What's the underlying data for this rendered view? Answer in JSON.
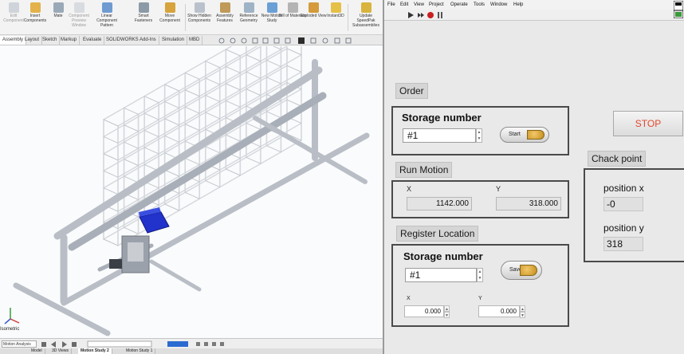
{
  "cad": {
    "ribbon": [
      {
        "label": "Edit Component",
        "disabled": true
      },
      {
        "label": "Insert Components",
        "disabled": false
      },
      {
        "label": "Mate",
        "disabled": false
      },
      {
        "label": "Component Preview Window",
        "disabled": true
      },
      {
        "label": "Linear Component Pattern",
        "disabled": false
      },
      {
        "label": "Smart Fasteners",
        "disabled": false
      },
      {
        "label": "Move Component",
        "disabled": false
      },
      {
        "label": "Show Hidden Components",
        "disabled": false
      },
      {
        "label": "Assembly Features",
        "disabled": false
      },
      {
        "label": "Reference Geometry",
        "disabled": false
      },
      {
        "label": "New Motion Study",
        "disabled": false
      },
      {
        "label": "Bill of Materials",
        "disabled": false
      },
      {
        "label": "Exploded View",
        "disabled": false
      },
      {
        "label": "Instant3D",
        "disabled": false
      },
      {
        "label": "Update SpeedPak Subassemblies",
        "disabled": false
      }
    ],
    "tabs": [
      "Assembly",
      "Layout",
      "Sketch",
      "Markup",
      "Evaluate",
      "SOLIDWORKS Add-Ins",
      "Simulation",
      "MBD"
    ],
    "active_tab": "Assembly",
    "triad_label": "Isometric",
    "motion_type": "Motion Analysis",
    "bottom_tabs": [
      "Model",
      "3D Views",
      "Motion Study 2",
      "Motion Study 1"
    ],
    "active_bottom_tab": "Motion Study 2",
    "colors": {
      "bin": "#2233cc",
      "frame": "#b9bec6",
      "rack": "#d4d7dc"
    }
  },
  "labview": {
    "menu": [
      "File",
      "Edit",
      "View",
      "Project",
      "Operate",
      "Tools",
      "Window",
      "Help"
    ],
    "order": {
      "label": "Order",
      "storage_number_label": "Storage number",
      "storage_number_value": "#1",
      "start_label": "Start"
    },
    "stop_label": "STOP",
    "run_motion": {
      "label": "Run Motion",
      "x_label": "X",
      "y_label": "Y",
      "x_value": "1142.000",
      "y_value": "318.000"
    },
    "register_location": {
      "label": "Register Location",
      "storage_number_label": "Storage number",
      "storage_number_value": "#1",
      "save_label": "Save",
      "x_label": "X",
      "y_label": "Y",
      "x_value": "0.000",
      "y_value": "0.000"
    },
    "check_point": {
      "label": "Chack point",
      "position_x_label": "position x",
      "position_x_value": "-0",
      "position_y_label": "position y",
      "position_y_value": "318"
    },
    "colors": {
      "stop_text": "#e0472c",
      "led": "#d9a02c",
      "background": "#e9e9e9"
    }
  }
}
